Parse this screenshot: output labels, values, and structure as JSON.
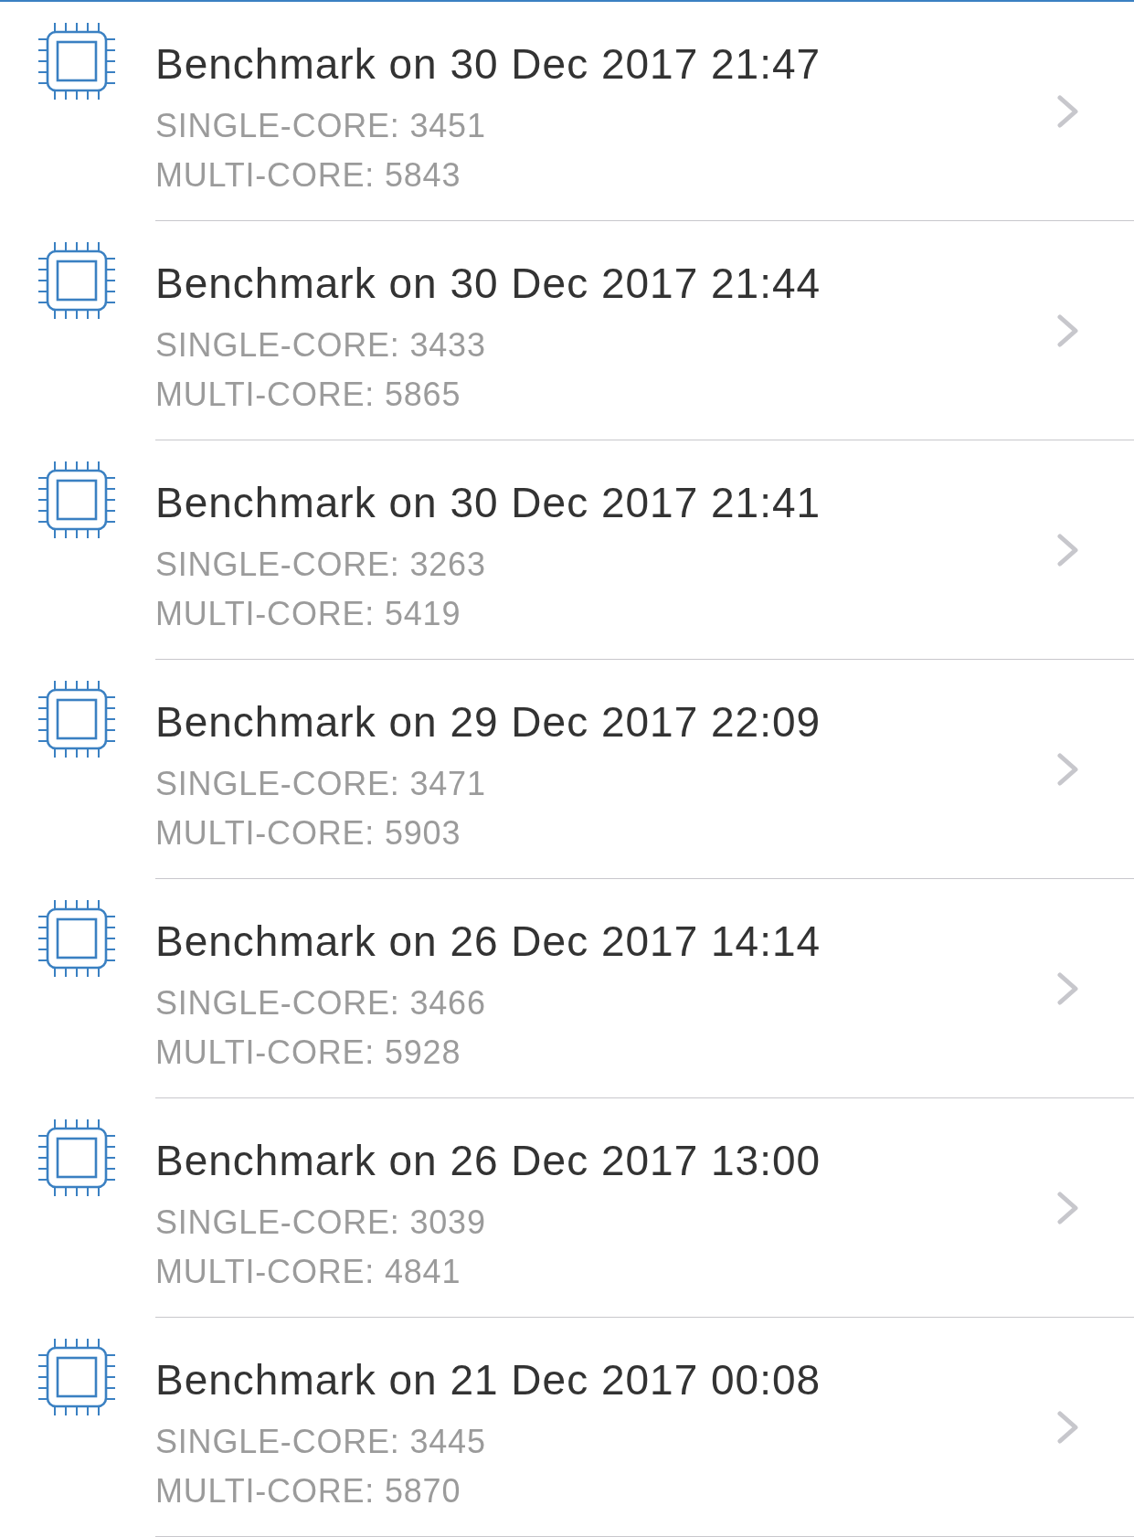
{
  "benchmarks": [
    {
      "title": "Benchmark on 30 Dec 2017 21:47",
      "single_core": "SINGLE-CORE: 3451",
      "multi_core": "MULTI-CORE: 5843"
    },
    {
      "title": "Benchmark on 30 Dec 2017 21:44",
      "single_core": "SINGLE-CORE: 3433",
      "multi_core": "MULTI-CORE: 5865"
    },
    {
      "title": "Benchmark on 30 Dec 2017 21:41",
      "single_core": "SINGLE-CORE: 3263",
      "multi_core": "MULTI-CORE: 5419"
    },
    {
      "title": "Benchmark on 29 Dec 2017 22:09",
      "single_core": "SINGLE-CORE: 3471",
      "multi_core": "MULTI-CORE: 5903"
    },
    {
      "title": "Benchmark on 26 Dec 2017 14:14",
      "single_core": "SINGLE-CORE: 3466",
      "multi_core": "MULTI-CORE: 5928"
    },
    {
      "title": "Benchmark on 26 Dec 2017 13:00",
      "single_core": "SINGLE-CORE: 3039",
      "multi_core": "MULTI-CORE: 4841"
    },
    {
      "title": "Benchmark on 21 Dec 2017 00:08",
      "single_core": "SINGLE-CORE: 3445",
      "multi_core": "MULTI-CORE: 5870"
    }
  ]
}
